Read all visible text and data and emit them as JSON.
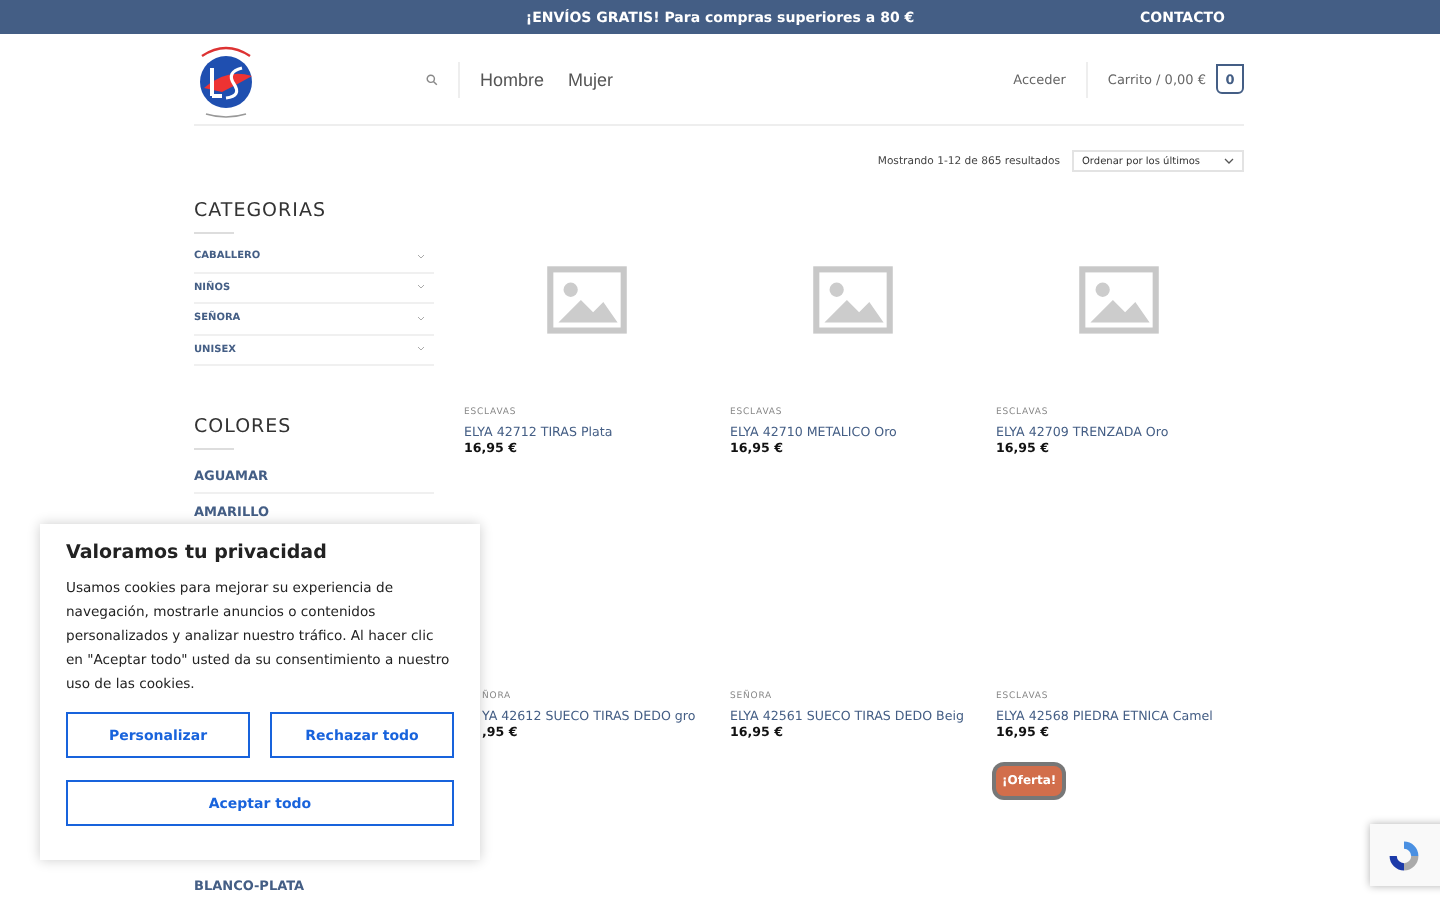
{
  "topbar": {
    "promo": "¡ENVÍOS GRATIS! Para compras superiores a 80 €",
    "contact": "CONTACTO"
  },
  "header": {
    "nav": [
      "Hombre",
      "Mujer"
    ],
    "login": "Acceder",
    "cart": "Carrito / 0,00 €",
    "cart_count": "0"
  },
  "results": {
    "text": "Mostrando 1-12 de 865 resultados",
    "sort": "Ordenar por los últimos"
  },
  "sidebar": {
    "categories_title": "CATEGORIAS",
    "categories": [
      "CABALLERO",
      "NIÑOS",
      "SEÑORA",
      "UNISEX"
    ],
    "colors_title": "COLORES",
    "colors": [
      "AGUAMAR",
      "AMARILLO",
      "BLANCO-PLATA"
    ]
  },
  "products": [
    {
      "category": "ESCLAVAS",
      "name": "ELYA 42712 TIRAS Plata",
      "price": "16,95 €",
      "placeholder": true
    },
    {
      "category": "ESCLAVAS",
      "name": "ELYA 42710 METALICO Oro",
      "price": "16,95 €",
      "placeholder": true
    },
    {
      "category": "ESCLAVAS",
      "name": "ELYA 42709 TRENZADA Oro",
      "price": "16,95 €",
      "placeholder": true
    },
    {
      "category": "ÑORA",
      "name": "YA 42612 SUECO TIRAS DEDO gro",
      "price": ",95 €",
      "placeholder": false
    },
    {
      "category": "SEÑORA",
      "name": "ELYA 42561 SUECO TIRAS DEDO Beig",
      "price": "16,95 €",
      "placeholder": false
    },
    {
      "category": "ESCLAVAS",
      "name": "ELYA 42568 PIEDRA ETNICA Camel",
      "price": "16,95 €",
      "placeholder": false
    }
  ],
  "sale_badge": "¡Oferta!",
  "cookie_banner": {
    "title": "Valoramos tu privacidad",
    "text": "Usamos cookies para mejorar su experiencia de navegación, mostrarle anuncios o contenidos personalizados y analizar nuestro tráfico. Al hacer clic en \"Aceptar todo\" usted da su consentimiento a nuestro uso de las cookies.",
    "buttons": [
      "Personalizar",
      "Rechazar todo"
    ],
    "accept": "Aceptar todo"
  }
}
